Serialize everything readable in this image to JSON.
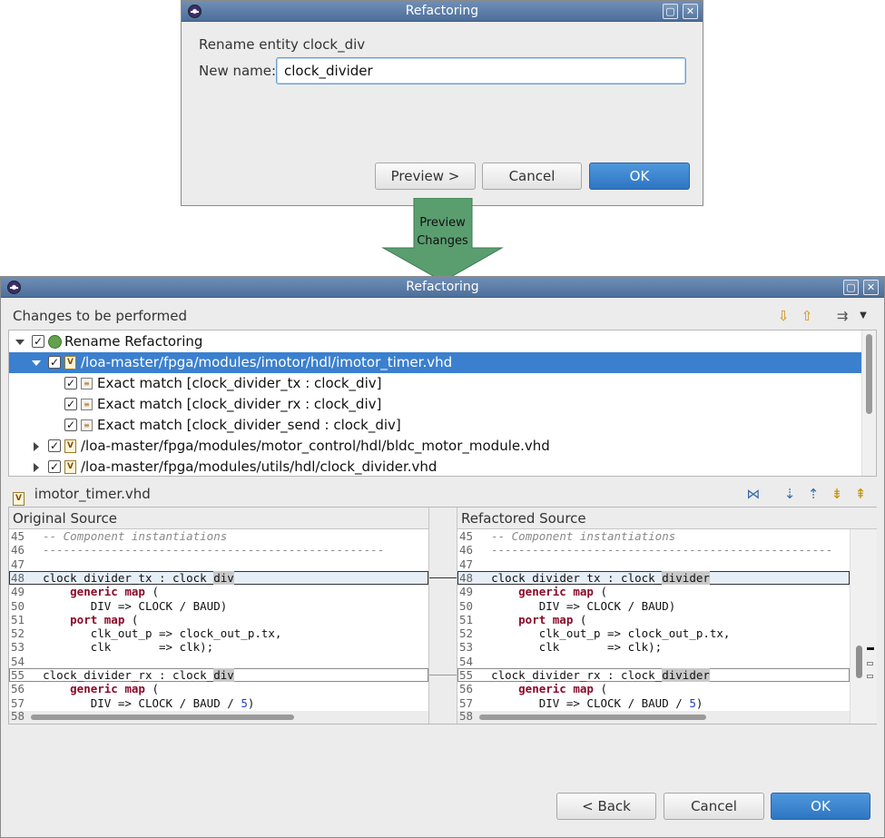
{
  "rename_dialog": {
    "title": "Refactoring",
    "heading": "Rename entity clock_div",
    "new_name_label": "New name:",
    "new_name_value": "clock_divider",
    "preview_button": "Preview >",
    "cancel_button": "Cancel",
    "ok_button": "OK"
  },
  "arrow": {
    "line1": "Preview",
    "line2": "Changes",
    "color": "#5a9e6f"
  },
  "preview_dialog": {
    "title": "Refactoring",
    "changes_header": "Changes to be performed",
    "tree": [
      {
        "label": "Rename Refactoring",
        "checked": true,
        "expanded": true
      },
      {
        "label": "/loa-master/fpga/modules/imotor/hdl/imotor_timer.vhd",
        "checked": true,
        "expanded": true,
        "selected": true
      },
      {
        "label": "Exact match [clock_divider_tx : clock_div]",
        "checked": true
      },
      {
        "label": "Exact match [clock_divider_rx : clock_div]",
        "checked": true
      },
      {
        "label": "Exact match [clock_divider_send : clock_div]",
        "checked": true
      },
      {
        "label": "/loa-master/fpga/modules/motor_control/hdl/bldc_motor_module.vhd",
        "checked": true,
        "expanded": false
      },
      {
        "label": "/loa-master/fpga/modules/utils/hdl/clock_divider.vhd",
        "checked": true,
        "expanded": false
      }
    ],
    "file_name": "imotor_timer.vhd",
    "original_header": "Original Source",
    "refactored_header": "Refactored Source",
    "back_button": "< Back",
    "cancel_button": "Cancel",
    "ok_button": "OK",
    "selection_color": "#3b80cf"
  },
  "code": {
    "line_numbers": [
      "45",
      "46",
      "47",
      "48",
      "49",
      "50",
      "51",
      "52",
      "53",
      "54",
      "55",
      "56",
      "57",
      "58"
    ],
    "comment": "-- Component instantiations",
    "dashes": "--------------------------------------------------",
    "inst_tx_prefix": "clock_divider_tx : clock_",
    "inst_rx_prefix": "clock_divider_rx : clock_",
    "orig_suffix": "div",
    "new_suffix": "divider",
    "generic_map": "generic map",
    "port_map": "port map",
    "paren": " (",
    "div_line": "DIV => CLOCK / BAUD)",
    "div_line_57": "DIV => CLOCK / BAUD / ",
    "num5": "5",
    "close_paren": ")",
    "clk_out_line": "clk_out_p => clock_out_p.tx,",
    "clk_line": "clk       => clk);"
  }
}
